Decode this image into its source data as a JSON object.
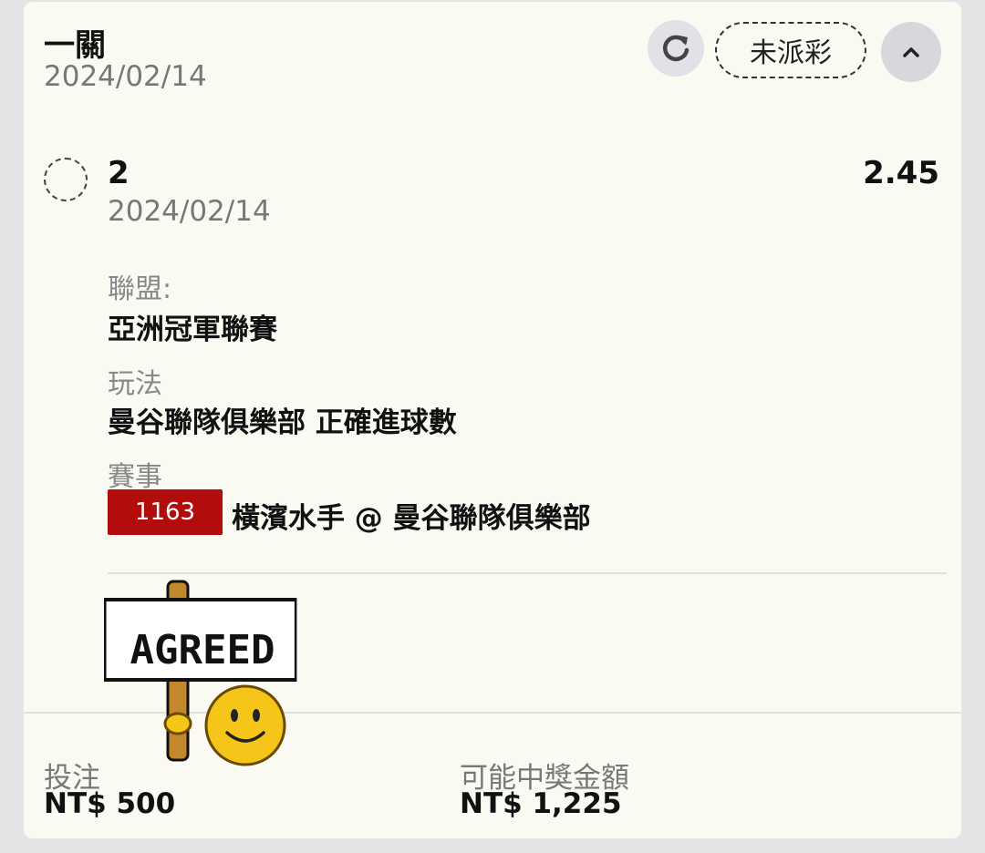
{
  "header": {
    "title": "一關",
    "date": "2024/02/14",
    "status": "未派彩"
  },
  "selection": {
    "name": "2",
    "date": "2024/02/14",
    "odds": "2.45"
  },
  "details": {
    "league_label": "聯盟:",
    "league_value": "亞洲冠軍聯賽",
    "bet_type_label": "玩法",
    "bet_type_value": "曼谷聯隊俱樂部 正確進球數",
    "event_label": "賽事",
    "event_number": "1163",
    "event_name": "橫濱水手 @ 曼谷聯隊俱樂部"
  },
  "sticker": {
    "sign_text": "AGREED",
    "icon": "smiley-holding-sign"
  },
  "summary": {
    "stake_label": "投注",
    "stake_value": "NT$ 500",
    "payout_label": "可能中獎金額",
    "payout_value": "NT$ 1,225"
  },
  "colors": {
    "badge": "#b30c0c",
    "card_bg": "#fbfaf2",
    "page_bg": "#e4e4e6"
  }
}
